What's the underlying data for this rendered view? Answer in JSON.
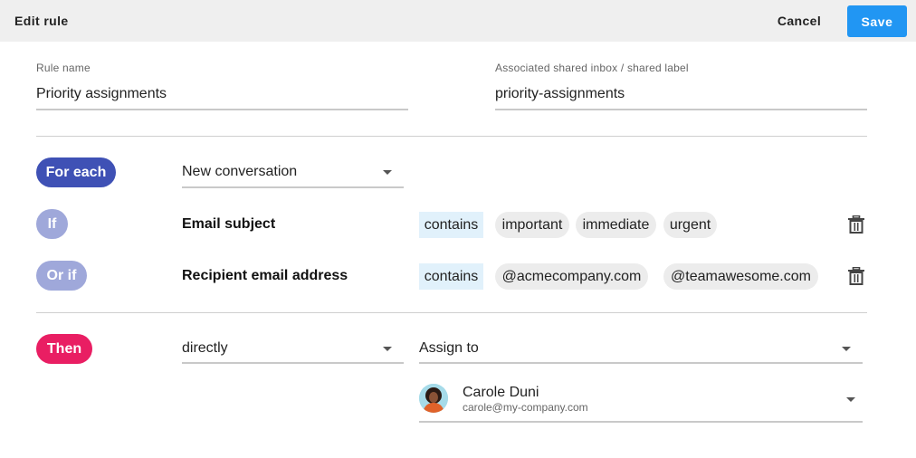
{
  "header": {
    "title": "Edit rule",
    "cancel_label": "Cancel",
    "save_label": "Save"
  },
  "rule_name": {
    "label": "Rule name",
    "value": "Priority assignments"
  },
  "shared_inbox": {
    "label": "Associated shared inbox / shared label",
    "value": "priority-assignments"
  },
  "for_each": {
    "pill": "For each",
    "selected": "New conversation"
  },
  "conditions": [
    {
      "pill": "If",
      "field": "Email subject",
      "operator": "contains",
      "values": [
        "important",
        "immediate",
        "urgent"
      ]
    },
    {
      "pill": "Or if",
      "field": "Recipient email address",
      "operator": "contains",
      "values": [
        "@acmecompany.com",
        "@teamawesome.com"
      ]
    }
  ],
  "then": {
    "pill": "Then",
    "mode": "directly",
    "action": "Assign to",
    "assignee": {
      "name": "Carole Duni",
      "email": "carole@my-company.com"
    }
  },
  "colors": {
    "save": "#2196f3",
    "for_each_pill": "#3f51b5",
    "condition_pill": "#9fa8da",
    "then_pill": "#e91e63",
    "operator_chip": "#e1f1fb",
    "value_chip": "#ececec"
  },
  "icons": {
    "delete": "trash-icon",
    "dropdown": "chevron-down-icon"
  }
}
